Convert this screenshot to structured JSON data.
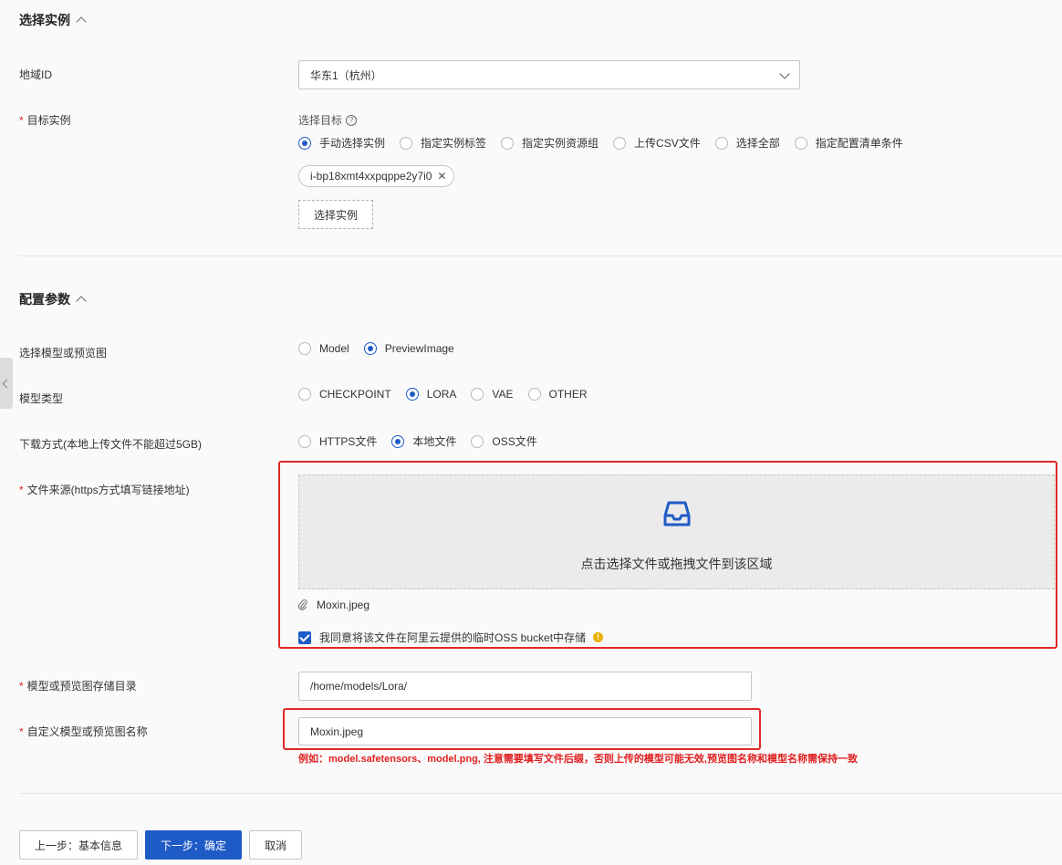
{
  "select_instance": {
    "section_title": "选择实例",
    "region": {
      "label": "地域ID",
      "value": "华东1（杭州）"
    },
    "target": {
      "label": "目标实例",
      "sub_label": "选择目标",
      "options": [
        "手动选择实例",
        "指定实例标签",
        "指定实例资源组",
        "上传CSV文件",
        "选择全部",
        "指定配置清单条件"
      ],
      "selected_index": 0,
      "tag_value": "i-bp18xmt4xxpqppe2y7i0",
      "select_button": "选择实例"
    }
  },
  "config": {
    "section_title": "配置参数",
    "model_or_preview": {
      "label": "选择模型或预览图",
      "options": [
        "Model",
        "PreviewImage"
      ],
      "selected_index": 1
    },
    "model_type": {
      "label": "模型类型",
      "options": [
        "CHECKPOINT",
        "LORA",
        "VAE",
        "OTHER"
      ],
      "selected_index": 1
    },
    "download_method": {
      "label": "下载方式(本地上传文件不能超过5GB)",
      "options": [
        "HTTPS文件",
        "本地文件",
        "OSS文件"
      ],
      "selected_index": 1
    },
    "file_source": {
      "label": "文件来源(https方式填写链接地址)",
      "upload_text": "点击选择文件或拖拽文件到该区域",
      "file_name": "Moxin.jpeg",
      "agree_text": "我同意将该文件在阿里云提供的临时OSS bucket中存储",
      "agree_checked": true
    },
    "storage_dir": {
      "label": "模型或预览图存储目录",
      "value": "/home/models/Lora/"
    },
    "custom_name": {
      "label": "自定义模型或预览图名称",
      "value": "Moxin.jpeg",
      "hint": "例如：model.safetensors、model.png, 注意需要填写文件后缀，否则上传的模型可能无效,预览图名称和模型名称需保持一致"
    }
  },
  "footer": {
    "prev_button": "上一步：基本信息",
    "next_button": "下一步：确定",
    "cancel_button": "取消"
  },
  "colors": {
    "primary": "#1f5bc7",
    "required": "#e02020",
    "highlight_border": "#e02828",
    "info": "#e8b000"
  }
}
